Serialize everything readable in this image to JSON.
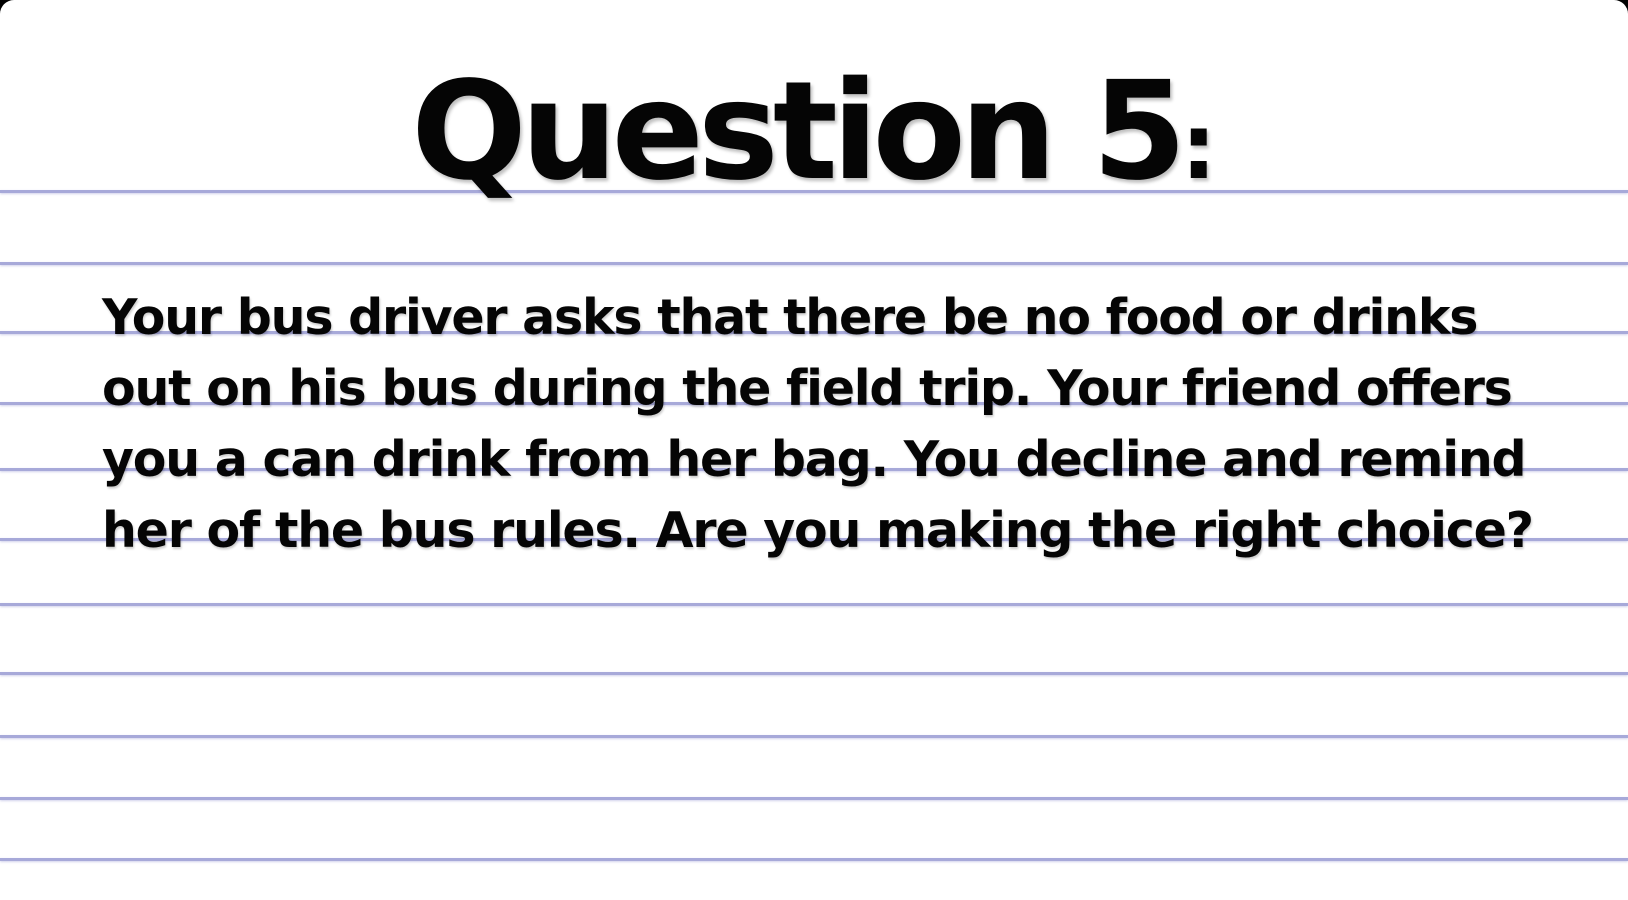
{
  "slide": {
    "title": "Question 5",
    "title_punct": ":",
    "question": "Your bus driver asks that there be no food or drinks out on his bus during the field trip. Your friend offers you a can drink from her bag. You decline and remind her of the bus rules. Are you making the right choice?"
  },
  "colors": {
    "paper": "#ffffff",
    "rule_line": "#a7a9d9",
    "text": "#050505",
    "frame": "#000000"
  }
}
